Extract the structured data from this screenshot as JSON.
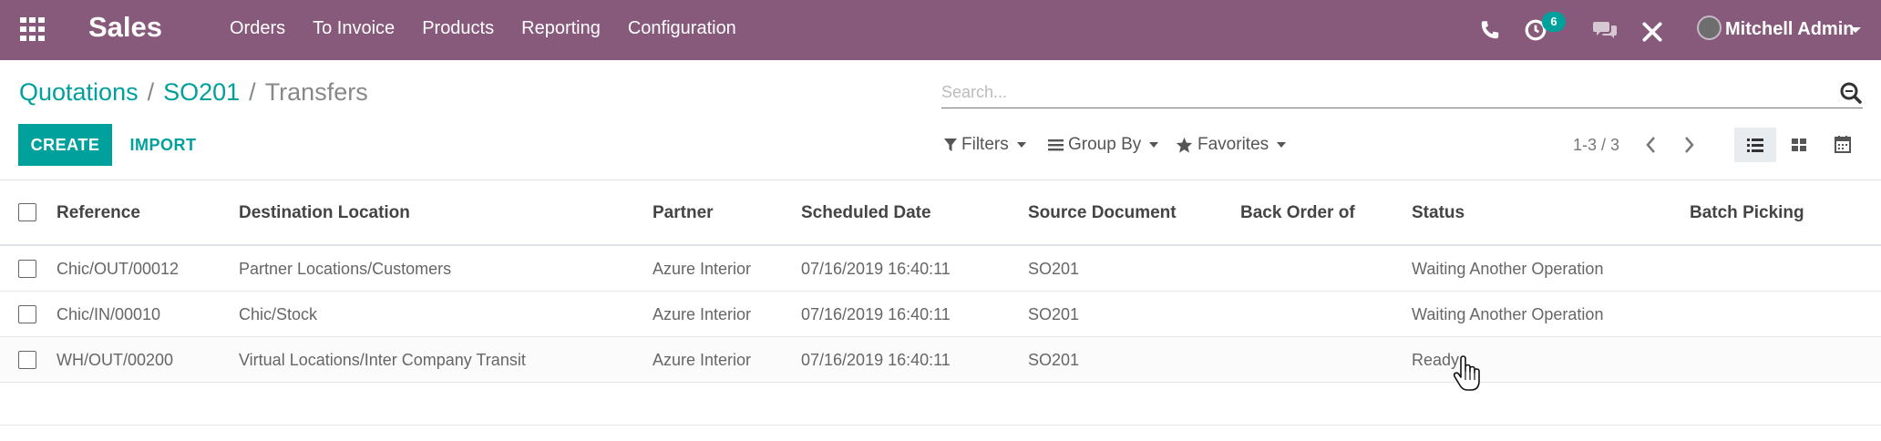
{
  "navbar": {
    "app_name": "Sales",
    "menu": [
      "Orders",
      "To Invoice",
      "Products",
      "Reporting",
      "Configuration"
    ],
    "activity_count": "6",
    "user_name": "Mitchell Admin",
    "bg_color": "#875a7b"
  },
  "breadcrumb": {
    "items": [
      "Quotations",
      "SO201"
    ],
    "current": "Transfers"
  },
  "search": {
    "placeholder": "Search..."
  },
  "buttons": {
    "create": "CREATE",
    "import": "IMPORT"
  },
  "search_options": {
    "filters": "Filters",
    "group_by": "Group By",
    "favorites": "Favorites"
  },
  "pager": {
    "value": "1-3 / 3"
  },
  "table": {
    "columns": [
      "Reference",
      "Destination Location",
      "Partner",
      "Scheduled Date",
      "Source Document",
      "Back Order of",
      "Status",
      "Batch Picking"
    ],
    "rows": [
      {
        "reference": "Chic/OUT/00012",
        "destination": "Partner Locations/Customers",
        "partner": "Azure Interior",
        "scheduled_date": "07/16/2019 16:40:11",
        "source": "SO201",
        "back_order": "",
        "status": "Waiting Another Operation",
        "batch": ""
      },
      {
        "reference": "Chic/IN/00010",
        "destination": "Chic/Stock",
        "partner": "Azure Interior",
        "scheduled_date": "07/16/2019 16:40:11",
        "source": "SO201",
        "back_order": "",
        "status": "Waiting Another Operation",
        "batch": ""
      },
      {
        "reference": "WH/OUT/00200",
        "destination": "Virtual Locations/Inter Company Transit",
        "partner": "Azure Interior",
        "scheduled_date": "07/16/2019 16:40:11",
        "source": "SO201",
        "back_order": "",
        "status": "Ready",
        "batch": ""
      }
    ]
  },
  "colors": {
    "accent": "#00a09d",
    "navbar": "#875a7b"
  }
}
